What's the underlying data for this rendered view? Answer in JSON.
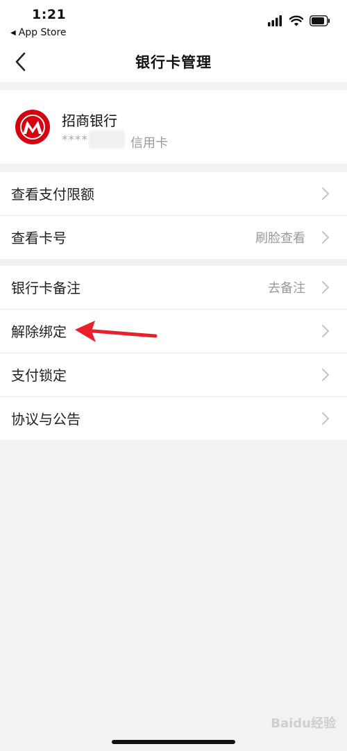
{
  "status_bar": {
    "time": "1:21",
    "back_app": "App Store"
  },
  "nav": {
    "title": "银行卡管理"
  },
  "card": {
    "bank_name": "招商银行",
    "masked_number": "****",
    "card_type": "信用卡"
  },
  "groups": [
    {
      "items": [
        {
          "label": "查看支付限额",
          "value": ""
        },
        {
          "label": "查看卡号",
          "value": "刷脸查看"
        }
      ]
    },
    {
      "items": [
        {
          "label": "银行卡备注",
          "value": "去备注"
        },
        {
          "label": "解除绑定",
          "value": ""
        },
        {
          "label": "支付锁定",
          "value": ""
        },
        {
          "label": "协议与公告",
          "value": ""
        }
      ]
    }
  ],
  "watermark": "Baidu经验",
  "colors": {
    "logo_red": "#d7000f",
    "annotation_red": "#e8202a",
    "background": "#f2f2f2"
  }
}
